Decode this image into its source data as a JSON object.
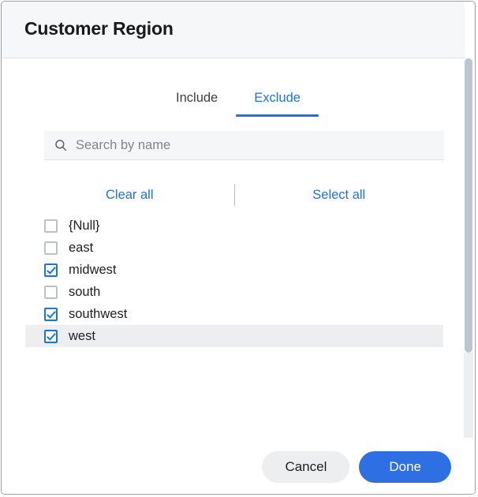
{
  "dialog": {
    "title": "Customer Region"
  },
  "tabs": [
    {
      "label": "Include",
      "active": false
    },
    {
      "label": "Exclude",
      "active": true
    }
  ],
  "search": {
    "icon": "search-icon",
    "placeholder": "Search by name",
    "value": ""
  },
  "bulk_actions": {
    "clear_all_label": "Clear all",
    "select_all_label": "Select all"
  },
  "options": [
    {
      "label": "{Null}",
      "checked": false,
      "highlighted": false
    },
    {
      "label": "east",
      "checked": false,
      "highlighted": false
    },
    {
      "label": "midwest",
      "checked": true,
      "highlighted": false
    },
    {
      "label": "south",
      "checked": false,
      "highlighted": false
    },
    {
      "label": "southwest",
      "checked": true,
      "highlighted": false
    },
    {
      "label": "west",
      "checked": true,
      "highlighted": true
    }
  ],
  "footer": {
    "cancel_label": "Cancel",
    "done_label": "Done"
  },
  "colors": {
    "accent": "#1a73e8",
    "primary_button": "#2f6fe4",
    "header_bg": "#f6f7f9",
    "search_bg": "#f5f6f7",
    "row_highlight": "#eceef0",
    "scrollbar_thumb": "#bdc5ce"
  }
}
